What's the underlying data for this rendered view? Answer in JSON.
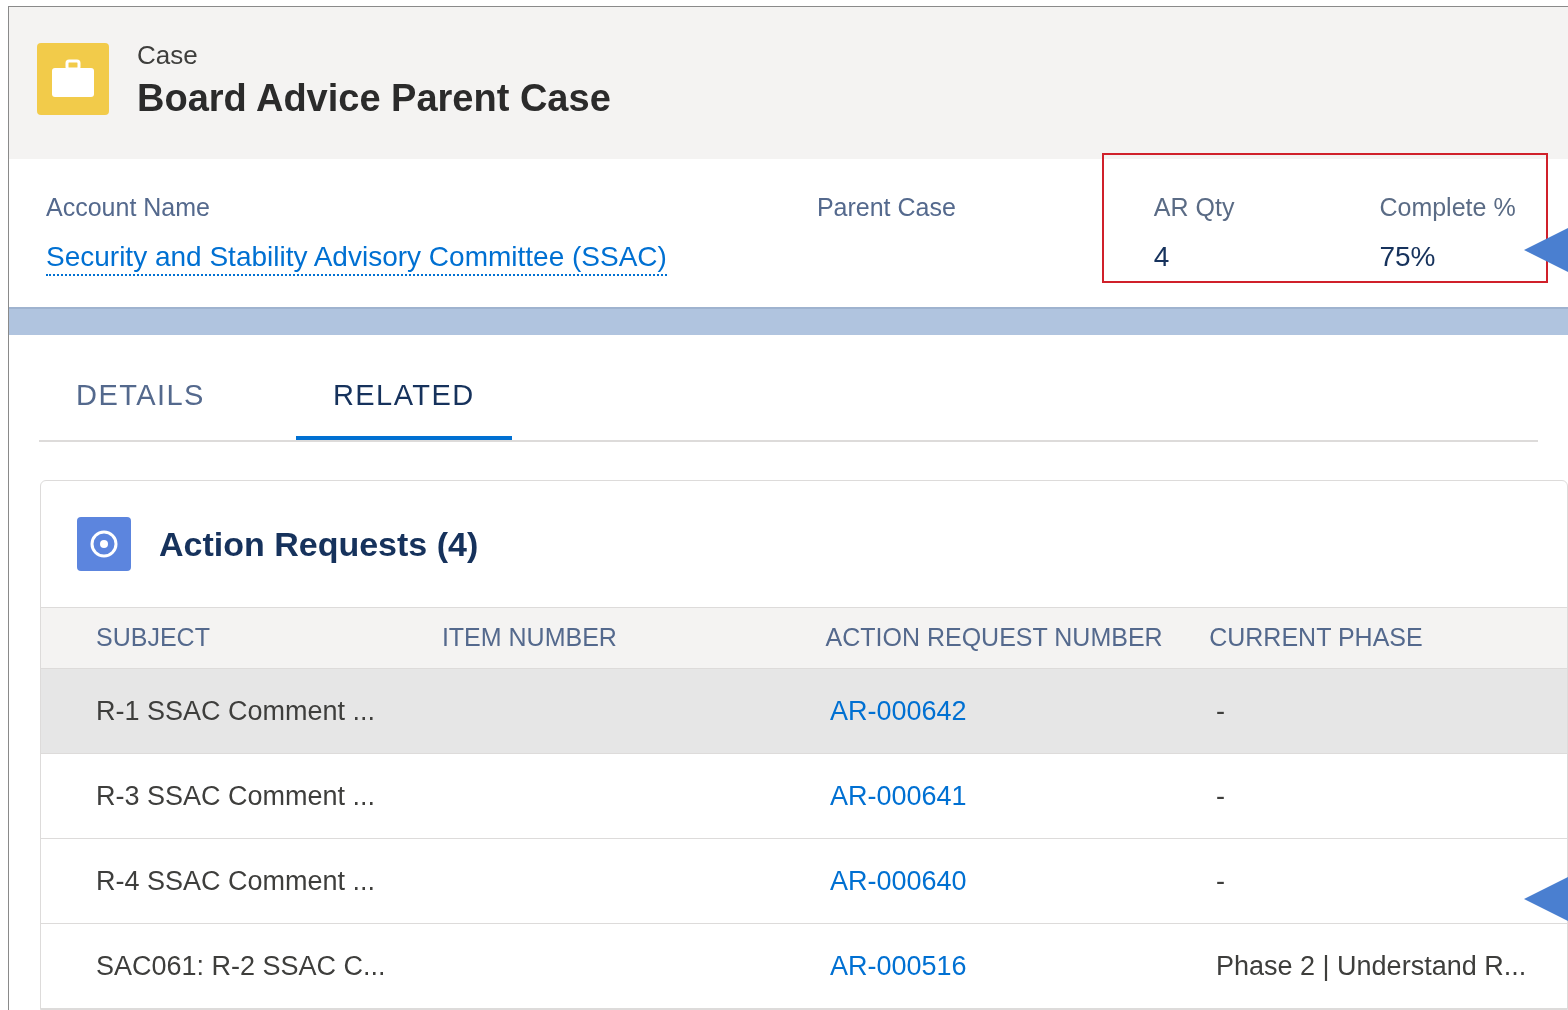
{
  "record": {
    "object": "Case",
    "title": "Board Advice Parent Case"
  },
  "highlights": [
    {
      "label": "Account Name",
      "value": "Security and Stability Advisory Committee (SSAC)",
      "kind": "link",
      "boxed": false
    },
    {
      "label": "Parent Case",
      "boxed": false
    },
    {
      "label": "AR Qty",
      "value": "4",
      "kind": "text",
      "boxed": true
    },
    {
      "label": "Complete %",
      "value": "75%",
      "kind": "text",
      "boxed": true
    }
  ],
  "tabs": [
    {
      "label": "DETAILS",
      "selected": false
    },
    {
      "label": "RELATED",
      "selected": true
    }
  ],
  "related_list": {
    "title": "Action Requests (4)",
    "columns": [
      "SUBJECT",
      "ITEM NUMBER",
      "ACTION REQUEST NUMBER",
      "CURRENT PHASE"
    ],
    "rows": [
      {
        "subject": "R-1 SSAC Comment ...",
        "action_request_number": "AR-000642",
        "current_phase": "-",
        "highlighted": true
      },
      {
        "subject": "R-3 SSAC Comment ...",
        "action_request_number": "AR-000641",
        "current_phase": "-",
        "highlighted": false
      },
      {
        "subject": "R-4 SSAC Comment ...",
        "action_request_number": "AR-000640",
        "current_phase": "-",
        "highlighted": false
      },
      {
        "subject": "SAC061: R-2 SSAC C...",
        "action_request_number": "AR-000516",
        "current_phase": "Phase 2 | Understand R...",
        "highlighted": false
      }
    ]
  }
}
